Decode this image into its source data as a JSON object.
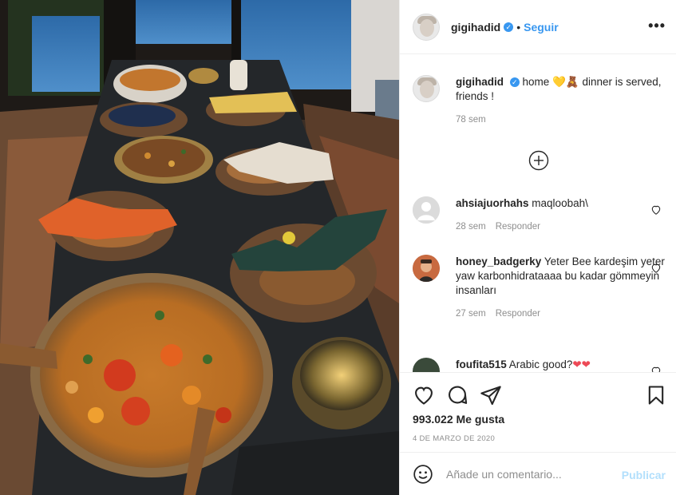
{
  "post": {
    "username": "gigihadid",
    "follow_label": "Seguir",
    "separator": "•",
    "more_label": "•••"
  },
  "caption": {
    "username": "gigihadid",
    "text_before": "home ",
    "emoji_1": "💛",
    "emoji_2": "🧸",
    "text_after": " dinner is served, friends !",
    "time": "78 sem"
  },
  "comments": [
    {
      "username": "ahsiajuorhahs",
      "text": "maqloobah\\",
      "time": "28 sem",
      "reply": "Responder"
    },
    {
      "username": "honey_badgerky",
      "text": "Yeter Bee kardeşim yeter yaw karbonhidrataaaa bu kadar gömmeyin insanları",
      "time": "27 sem",
      "reply": "Responder"
    },
    {
      "username": "foufita515",
      "text": "Arabic good?",
      "emoji": "❤❤"
    }
  ],
  "engagement": {
    "likes": "993.022 Me gusta",
    "date": "4 DE MARZO DE 2020"
  },
  "add_comment": {
    "placeholder": "Añade un comentario...",
    "publish_label": "Publicar"
  },
  "colors": {
    "link_blue": "#3897f0",
    "publish_disabled": "#b2dffc",
    "meta_gray": "#8e8e8e",
    "heart_red": "#ed4956"
  }
}
